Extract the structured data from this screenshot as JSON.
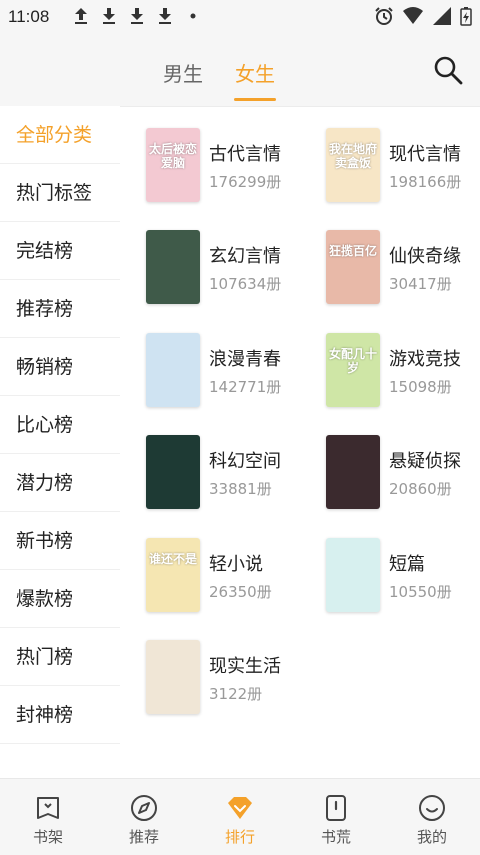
{
  "status_bar": {
    "time": "11:08"
  },
  "header": {
    "tabs": [
      "男生",
      "女生"
    ],
    "active_tab": "女生"
  },
  "sidebar": {
    "items": [
      "全部分类",
      "热门标签",
      "完结榜",
      "推荐榜",
      "畅销榜",
      "比心榜",
      "潜力榜",
      "新书榜",
      "爆款榜",
      "热门榜",
      "封神榜"
    ],
    "active": "全部分类"
  },
  "categories": [
    {
      "name": "古代言情",
      "count": "176299册",
      "cover_text": "太后被恋爱脑",
      "cover_color": "#f3c9d2"
    },
    {
      "name": "现代言情",
      "count": "198166册",
      "cover_text": "我在地府卖盒饭",
      "cover_color": "#f7e6c6"
    },
    {
      "name": "玄幻言情",
      "count": "107634册",
      "cover_text": "",
      "cover_color": "#3f5a49"
    },
    {
      "name": "仙侠奇缘",
      "count": "30417册",
      "cover_text": "狂揽百亿",
      "cover_color": "#e8b9a8"
    },
    {
      "name": "浪漫青春",
      "count": "142771册",
      "cover_text": "",
      "cover_color": "#cfe3f2"
    },
    {
      "name": "游戏竞技",
      "count": "15098册",
      "cover_text": "女配几十岁",
      "cover_color": "#cfe6a6"
    },
    {
      "name": "科幻空间",
      "count": "33881册",
      "cover_text": "",
      "cover_color": "#1e3a34"
    },
    {
      "name": "悬疑侦探",
      "count": "20860册",
      "cover_text": "",
      "cover_color": "#3b2a2e"
    },
    {
      "name": "轻小说",
      "count": "26350册",
      "cover_text": "谁还不是",
      "cover_color": "#f5e6b2"
    },
    {
      "name": "短篇",
      "count": "10550册",
      "cover_text": "",
      "cover_color": "#d7f0ef"
    },
    {
      "name": "现实生活",
      "count": "3122册",
      "cover_text": "",
      "cover_color": "#f0e6d6"
    }
  ],
  "bottom_nav": {
    "items": [
      {
        "label": "书架",
        "icon": "bookshelf-icon"
      },
      {
        "label": "推荐",
        "icon": "compass-icon"
      },
      {
        "label": "排行",
        "icon": "diamond-icon"
      },
      {
        "label": "书荒",
        "icon": "book-alert-icon"
      },
      {
        "label": "我的",
        "icon": "smiley-icon"
      }
    ],
    "active": "排行"
  },
  "colors": {
    "accent": "#f4a12a",
    "text": "#222222",
    "muted": "#999999"
  }
}
